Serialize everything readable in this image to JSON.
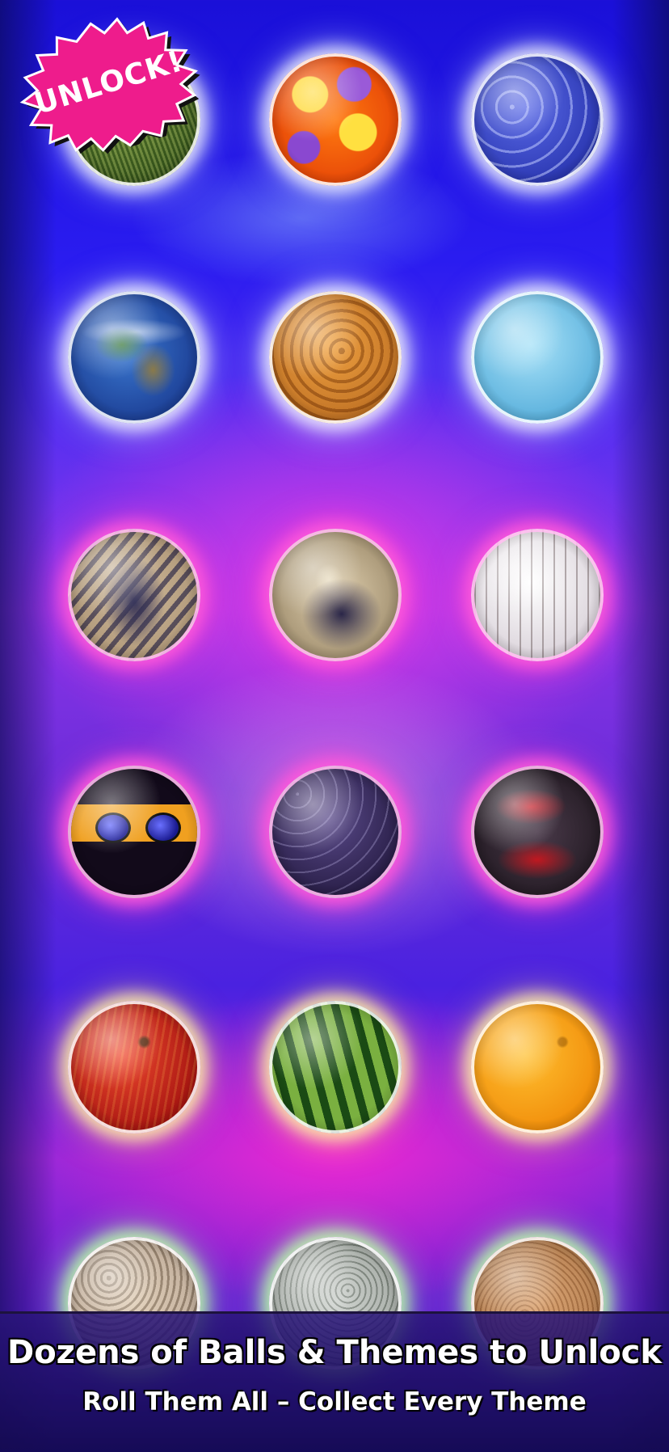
{
  "badge": {
    "label": "UNLOCK!",
    "color": "#ee1c8c"
  },
  "balls": [
    {
      "row": 1,
      "name": "grass-ball"
    },
    {
      "row": 1,
      "name": "flower-ball"
    },
    {
      "row": 1,
      "name": "water-ball"
    },
    {
      "row": 2,
      "name": "earth-ball"
    },
    {
      "row": 2,
      "name": "venus-ball"
    },
    {
      "row": 2,
      "name": "uranus-ball"
    },
    {
      "row": 3,
      "name": "samurai-art-ball"
    },
    {
      "row": 3,
      "name": "geisha-art-ball"
    },
    {
      "row": 3,
      "name": "calligraphy-ball"
    },
    {
      "row": 4,
      "name": "ninja-ball"
    },
    {
      "row": 4,
      "name": "scales-ball"
    },
    {
      "row": 4,
      "name": "kanji-ball"
    },
    {
      "row": 5,
      "name": "apple-ball"
    },
    {
      "row": 5,
      "name": "watermelon-ball"
    },
    {
      "row": 5,
      "name": "orange-ball"
    },
    {
      "row": 6,
      "name": "pebble-ball"
    },
    {
      "row": 6,
      "name": "granite-ball"
    },
    {
      "row": 6,
      "name": "cork-ball"
    }
  ],
  "banner": {
    "headline": "Dozens of Balls & Themes to Unlock",
    "subline": "Roll Them All – Collect Every Theme"
  },
  "colors": {
    "background_blue": "#2a1cf0",
    "background_magenta": "#e03ce6",
    "banner_bg": "#1e0f60"
  }
}
